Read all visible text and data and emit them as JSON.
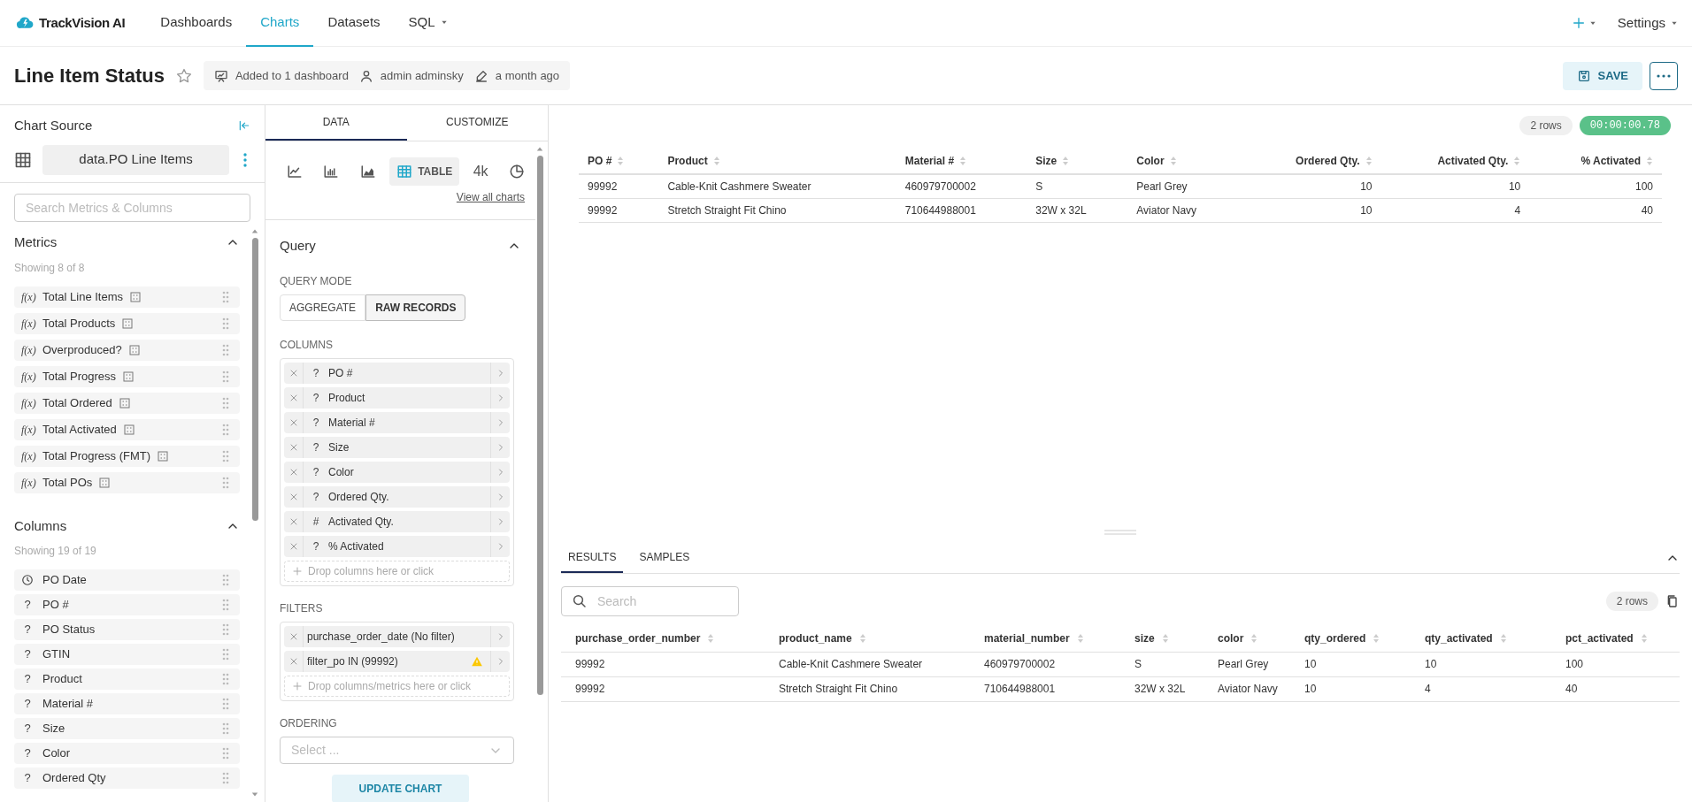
{
  "nav": {
    "brand": "TrackVision AI",
    "items": [
      {
        "label": "Dashboards",
        "selected": false,
        "dropdown": false
      },
      {
        "label": "Charts",
        "selected": true,
        "dropdown": false
      },
      {
        "label": "Datasets",
        "selected": false,
        "dropdown": false
      },
      {
        "label": "SQL",
        "selected": false,
        "dropdown": true
      }
    ],
    "settings": "Settings"
  },
  "header": {
    "title": "Line Item Status",
    "starred": false,
    "dashboards": "Added to 1 dashboard",
    "owner": "admin adminsky",
    "modified": "a month ago",
    "save": "SAVE"
  },
  "source_panel": {
    "title": "Chart Source",
    "dataset": "data.PO Line Items",
    "search_placeholder": "Search Metrics & Columns",
    "metrics": {
      "title": "Metrics",
      "count": "Showing 8 of 8",
      "items": [
        {
          "prefix": "f(x)",
          "label": "Total Line Items"
        },
        {
          "prefix": "f(x)",
          "label": "Total Products"
        },
        {
          "prefix": "f(x)",
          "label": "Overproduced?"
        },
        {
          "prefix": "f(x)",
          "label": "Total Progress"
        },
        {
          "prefix": "f(x)",
          "label": "Total Ordered"
        },
        {
          "prefix": "f(x)",
          "label": "Total Activated"
        },
        {
          "prefix": "f(x)",
          "label": "Total Progress (FMT)"
        },
        {
          "prefix": "f(x)",
          "label": "Total POs"
        }
      ]
    },
    "columns": {
      "title": "Columns",
      "count": "Showing 19 of 19",
      "items": [
        {
          "kind": "time",
          "label": "PO Date"
        },
        {
          "kind": "glyph",
          "glyph": "?",
          "label": "PO #"
        },
        {
          "kind": "glyph",
          "glyph": "?",
          "label": "PO Status"
        },
        {
          "kind": "glyph",
          "glyph": "?",
          "label": "GTIN"
        },
        {
          "kind": "glyph",
          "glyph": "?",
          "label": "Product"
        },
        {
          "kind": "glyph",
          "glyph": "?",
          "label": "Material #"
        },
        {
          "kind": "glyph",
          "glyph": "?",
          "label": "Size"
        },
        {
          "kind": "glyph",
          "glyph": "?",
          "label": "Color"
        },
        {
          "kind": "glyph",
          "glyph": "?",
          "label": "Ordered Qty"
        }
      ]
    }
  },
  "config_panel": {
    "tabs": [
      {
        "label": "DATA",
        "selected": true
      },
      {
        "label": "CUSTOMIZE",
        "selected": false
      }
    ],
    "chart_types": [
      {
        "kind": "line",
        "selected": false
      },
      {
        "kind": "bar",
        "selected": false
      },
      {
        "kind": "area",
        "selected": false
      },
      {
        "kind": "table",
        "label": "TABLE",
        "selected": true
      },
      {
        "kind": "text",
        "label": "4k",
        "selected": false
      },
      {
        "kind": "pie",
        "selected": false
      }
    ],
    "view_all": "View all charts",
    "section": "Query",
    "query_mode_label": "QUERY MODE",
    "query_modes": [
      {
        "label": "AGGREGATE",
        "selected": false
      },
      {
        "label": "RAW RECORDS",
        "selected": true
      }
    ],
    "columns_label": "COLUMNS",
    "columns": [
      {
        "glyph": "?",
        "label": "PO #"
      },
      {
        "glyph": "?",
        "label": "Product"
      },
      {
        "glyph": "?",
        "label": "Material #"
      },
      {
        "glyph": "?",
        "label": "Size"
      },
      {
        "glyph": "?",
        "label": "Color"
      },
      {
        "glyph": "?",
        "label": "Ordered Qty."
      },
      {
        "glyph": "#",
        "label": "Activated Qty."
      },
      {
        "glyph": "?",
        "label": "% Activated"
      }
    ],
    "columns_drop": "Drop columns here or click",
    "filters_label": "FILTERS",
    "filters": [
      {
        "label": "purchase_order_date (No filter)",
        "warning": false
      },
      {
        "label": "filter_po IN (99992)",
        "warning": true
      }
    ],
    "filters_drop": "Drop columns/metrics here or click",
    "ordering_label": "ORDERING",
    "ordering_placeholder": "Select ...",
    "update": "UPDATE CHART"
  },
  "chart": {
    "row_count": "2 rows",
    "duration": "00:00:00.78",
    "columns": [
      {
        "label": "PO #",
        "numeric": false
      },
      {
        "label": "Product",
        "numeric": false
      },
      {
        "label": "Material #",
        "numeric": false
      },
      {
        "label": "Size",
        "numeric": false
      },
      {
        "label": "Color",
        "numeric": false
      },
      {
        "label": "Ordered Qty.",
        "numeric": true
      },
      {
        "label": "Activated Qty.",
        "numeric": true
      },
      {
        "label": "% Activated",
        "numeric": true
      }
    ],
    "rows": [
      [
        "99992",
        "Cable-Knit Cashmere Sweater",
        "460979700002",
        "S",
        "Pearl Grey",
        "10",
        "10",
        "100"
      ],
      [
        "99992",
        "Stretch Straight Fit Chino",
        "710644988001",
        "32W x 32L",
        "Aviator Navy",
        "10",
        "4",
        "40"
      ]
    ]
  },
  "results": {
    "tabs": [
      {
        "label": "RESULTS",
        "selected": true
      },
      {
        "label": "SAMPLES",
        "selected": false
      }
    ],
    "search_placeholder": "Search",
    "row_count": "2 rows",
    "columns": [
      "purchase_order_number",
      "product_name",
      "material_number",
      "size",
      "color",
      "qty_ordered",
      "qty_activated",
      "pct_activated"
    ],
    "rows": [
      [
        "99992",
        "Cable-Knit Cashmere Sweater",
        "460979700002",
        "S",
        "Pearl Grey",
        "10",
        "10",
        "100"
      ],
      [
        "99992",
        "Stretch Straight Fit Chino",
        "710644988001",
        "32W x 32L",
        "Aviator Navy",
        "10",
        "4",
        "40"
      ]
    ]
  }
}
